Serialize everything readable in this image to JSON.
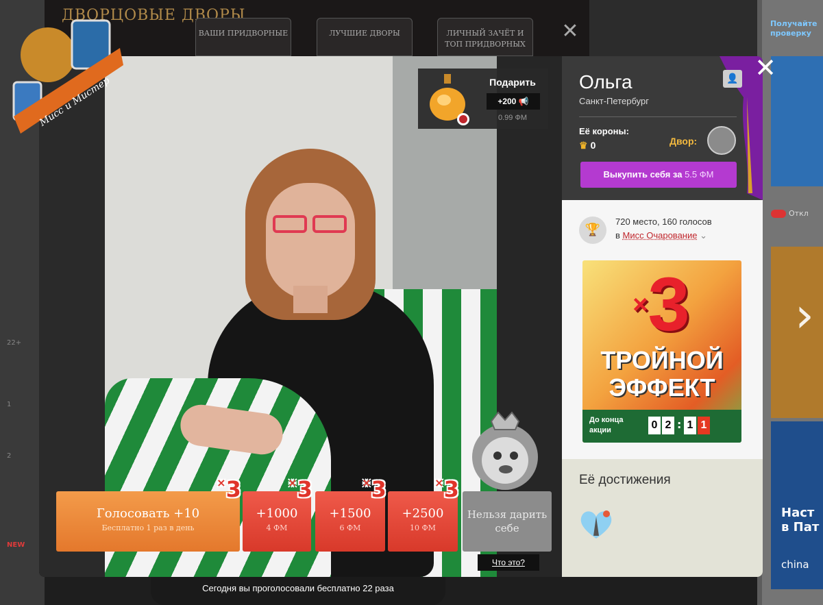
{
  "background": {
    "header_title": "ДВОРЦОВЫЕ ДВОРЫ",
    "tabs": [
      {
        "label": "ВАШИ ПРИДВОРНЫЕ"
      },
      {
        "label": "ЛУЧШИЕ ДВОРЫ"
      },
      {
        "label": "ЛИЧНЫЙ ЗАЧЁТ И ТОП ПРИДВОРНЫХ"
      }
    ],
    "left_badges": [
      "22+",
      "1",
      "2",
      "NEW"
    ],
    "right_promo": "Получайте проверку",
    "right_toggle": "Откл",
    "right_ad_text1": "Наст в Пат",
    "right_ad_text2": "china"
  },
  "logo": {
    "text": "Мисс и Мистер"
  },
  "gift": {
    "label": "Подарить",
    "points": "+200",
    "price": "0.99 ФМ"
  },
  "votes": {
    "main": {
      "label": "Голосовать +10",
      "sub": "Бесплатно 1 раз в день"
    },
    "paid": [
      {
        "label": "+1000",
        "sub": "4 ФМ"
      },
      {
        "label": "+1500",
        "sub": "6 ФМ"
      },
      {
        "label": "+2500",
        "sub": "10 ФМ"
      }
    ],
    "self": {
      "label": "Нельзя дарить себе"
    },
    "multiplier": "3",
    "what_link": "Что это?"
  },
  "profile": {
    "name": "Ольга",
    "city": "Санкт-Петербург",
    "crowns_label": "Её короны:",
    "crowns_value": "0",
    "dvor_label": "Двор:",
    "buy_label": "Выкупить себя за",
    "buy_price": "5.5 ФМ"
  },
  "rank": {
    "line1": "720 место, 160 голосов",
    "prefix": "в",
    "contest": "Мисс Очарование"
  },
  "promo": {
    "multiplier": "3",
    "line1": "ТРОЙНОЙ",
    "line2": "ЭФФЕКТ",
    "until": "До конца акции",
    "digits": [
      "0",
      "2",
      "1",
      "1"
    ]
  },
  "achievements": {
    "title": "Её достижения"
  },
  "footer": {
    "text": "Сегодня вы проголосовали бесплатно 22 раза"
  },
  "colors": {
    "vote_orange": "#e4782c",
    "vote_red": "#d8392a",
    "buy_purple": "#b43ad0",
    "contest_link": "#c0262c"
  }
}
